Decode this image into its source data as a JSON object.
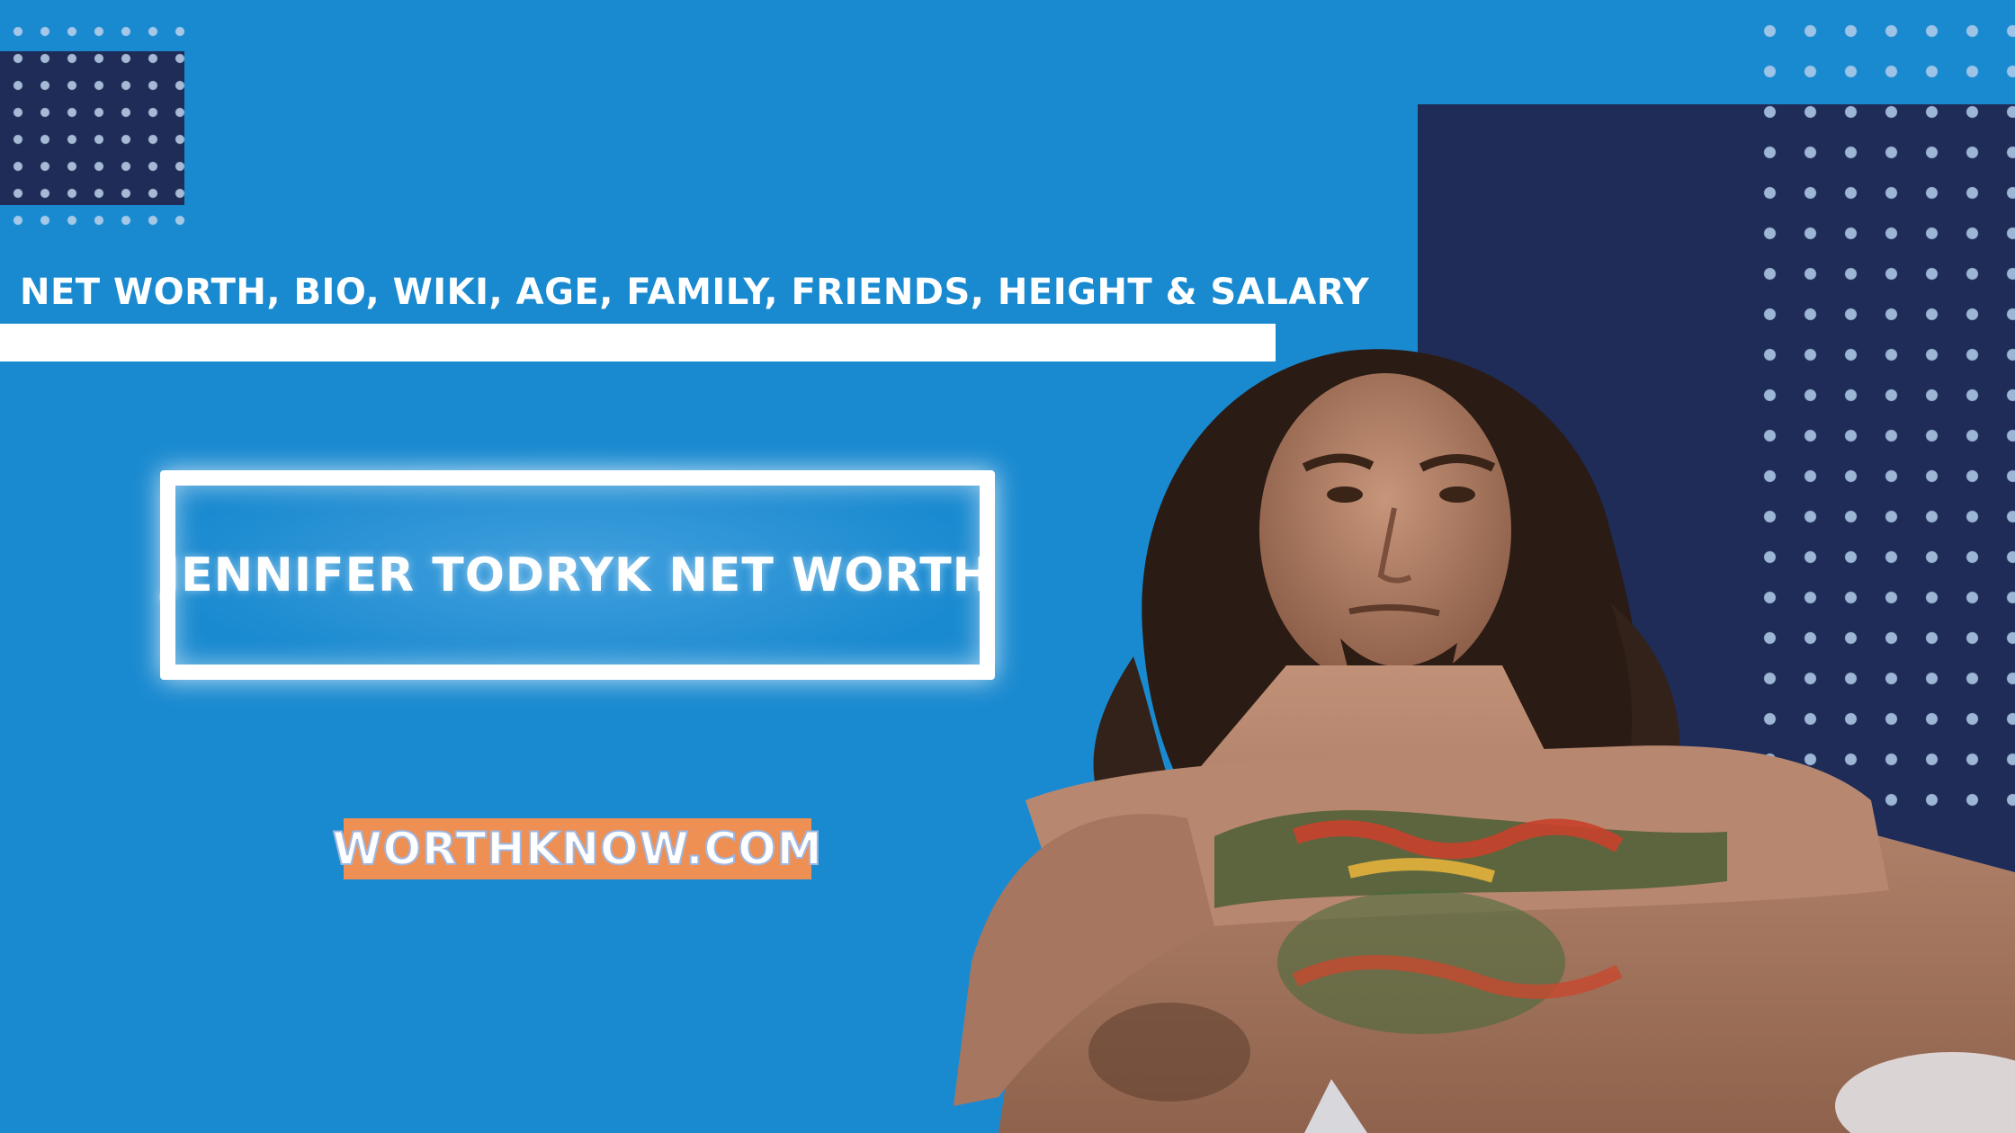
{
  "subtitle": "NET WORTH, BIO, WIKI, AGE, FAMILY, FRIENDS, HEIGHT & SALARY",
  "title": "JENNIFER TODRYK NET WORTH",
  "site": "WORTHKNOW.COM",
  "colors": {
    "background": "#1a8ad0",
    "navy": "#1e2c57",
    "badge": "#ee8f54",
    "text": "#ffffff"
  }
}
